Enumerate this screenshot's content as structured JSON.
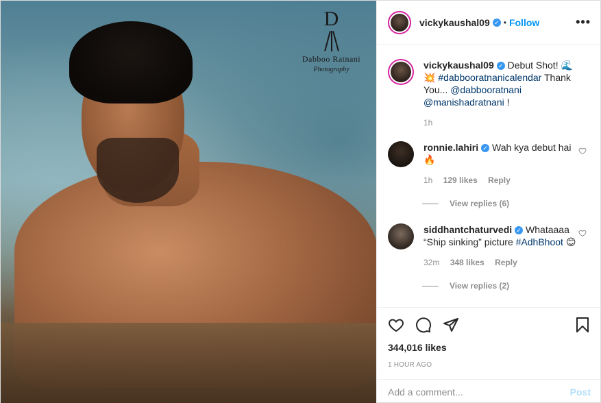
{
  "photo": {
    "brand_initial": "D",
    "brand_name": "Dabboo Ratnani",
    "brand_sub": "Photography"
  },
  "header": {
    "username": "vickykaushal09",
    "separator": "•",
    "follow_label": "Follow",
    "more_label": "•••"
  },
  "caption": {
    "username": "vickykaushal09",
    "text": "Debut Shot! 🌊💥",
    "hashtag": "#dabbooratnanicalendar",
    "text2": " Thank You...",
    "mention1": "@dabbooratnani",
    "mention2": "@manishadratnani",
    "text3": " !",
    "time": "1h"
  },
  "comments": [
    {
      "username": "ronnie.lahiri",
      "text": "Wah kya debut hai 🔥",
      "time": "1h",
      "likes": "129 likes",
      "reply_label": "Reply",
      "view_replies": "View replies (6)"
    },
    {
      "username": "siddhantchaturvedi",
      "text": "Whataaaa “Ship sinking” picture",
      "hashtag": "#AdhBhoot",
      "emoji": "😊",
      "time": "32m",
      "likes": "348 likes",
      "reply_label": "Reply",
      "view_replies": "View replies (2)"
    }
  ],
  "actions": {
    "likes": "344,016 likes",
    "timestamp": "1 HOUR AGO"
  },
  "add_comment": {
    "placeholder": "Add a comment...",
    "post_label": "Post"
  },
  "icons": [
    "heart-icon",
    "comment-icon",
    "share-icon",
    "bookmark-icon",
    "verified-icon",
    "more-icon"
  ],
  "colors": {
    "link": "#00376b",
    "follow": "#0095f6",
    "verified": "#3897f0",
    "post_disabled": "#b2dffc",
    "muted": "#8e8e8e"
  }
}
